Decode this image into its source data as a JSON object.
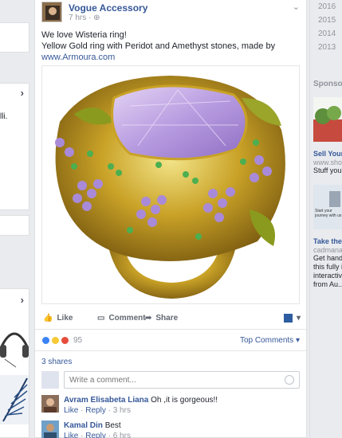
{
  "post": {
    "page_name": "Vogue Accessory",
    "time": "7 hrs · ",
    "text_line1": "We love Wisteria ring!",
    "text_line2": "Yellow Gold ring with Peridot and Amethyst stones, made by",
    "link": "www.Armoura.com",
    "actions": {
      "like": "Like",
      "comment": "Comment",
      "share": "Share"
    },
    "reaction_count": "95",
    "top_comments": "Top Comments",
    "shares": "3 shares",
    "comment_placeholder": "Write a comment...",
    "comments": [
      {
        "name": "Avram Elisabeta Liana",
        "text": "Oh ,it is gorgeous!!",
        "like": "Like",
        "reply": "Reply",
        "time": "3 hrs"
      },
      {
        "name": "Kamal Din",
        "text": "Best",
        "like": "Like",
        "reply": "Reply",
        "time": "6 hrs"
      }
    ]
  },
  "left": {
    "snippet": "lli."
  },
  "right": {
    "years": [
      "2016",
      "2015",
      "2014",
      "2013"
    ],
    "sponsored": "Sponsore",
    "ad1": {
      "title": "Sell Your C",
      "url": "www.shop",
      "desc": "Stuff your c"
    },
    "ad2": {
      "banner_line1": "Start your",
      "banner_line2": "journey with us",
      "title": "Take the A",
      "url": "cadmanag",
      "desc": [
        "Get hands",
        "this fully in",
        "interactive",
        "from Au..."
      ]
    }
  },
  "colors": {
    "link": "#365899",
    "meta": "#90949c",
    "gold": "#c9a227",
    "amethyst": "#b79be0"
  }
}
